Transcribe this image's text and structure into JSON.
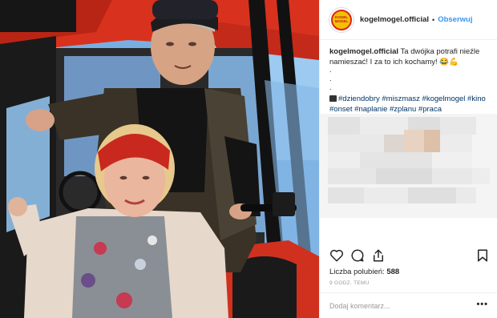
{
  "header": {
    "username": "kogelmogel.official",
    "separator": "•",
    "follow_label": "Obserwuj",
    "avatar_text": "KOGEL MOGEL"
  },
  "caption": {
    "username": "kogelmogel.official",
    "text": "Ta dwójka potrafi nieźle namieszać! I za to ich kochamy! 😂💪",
    "dots": ".\n.\n.",
    "hashtags": "#dziendobry #miszmasz #kogelmogel #kino #onset #naplanie #zplanu #praca"
  },
  "actions": {
    "like_icon": "heart-icon",
    "comment_icon": "comment-icon",
    "share_icon": "share-icon",
    "save_icon": "bookmark-icon"
  },
  "likes": {
    "label": "Liczba polubień:",
    "count": "588"
  },
  "timestamp": "9 GODZ. TEMU",
  "comment_box": {
    "placeholder": "Dodaj komentarz...",
    "more": "•••"
  },
  "colors": {
    "link": "#3897f0",
    "hashtag": "#003569",
    "tractor_red": "#d8321f"
  }
}
